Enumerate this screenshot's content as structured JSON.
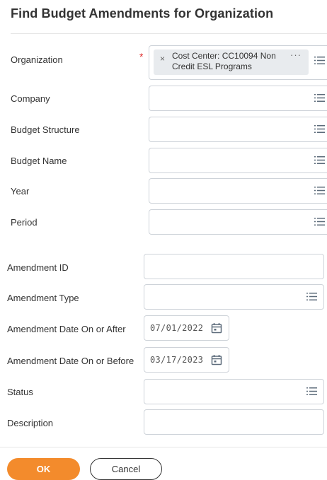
{
  "header": {
    "title": "Find Budget Amendments for Organization"
  },
  "form": {
    "organization": {
      "label": "Organization",
      "required_mark": "*",
      "selected_line1": "Cost Center: CC10094 Non",
      "selected_line2": "Credit ESL Programs",
      "remove_glyph": "×",
      "more_glyph": "···"
    },
    "company": {
      "label": "Company"
    },
    "budget_structure": {
      "label": "Budget Structure"
    },
    "budget_name": {
      "label": "Budget Name"
    },
    "year": {
      "label": "Year"
    },
    "period": {
      "label": "Period"
    },
    "amendment_id": {
      "label": "Amendment ID"
    },
    "amendment_type": {
      "label": "Amendment Type"
    },
    "date_after": {
      "label": "Amendment Date On or After",
      "value": "07/01/2022"
    },
    "date_before": {
      "label": "Amendment Date On or Before",
      "value": "03/17/2023"
    },
    "status": {
      "label": "Status"
    },
    "description": {
      "label": "Description"
    }
  },
  "buttons": {
    "ok": "OK",
    "cancel": "Cancel"
  },
  "icons": {
    "list": "list-icon",
    "calendar": "calendar-icon",
    "remove": "close-icon",
    "more": "more-icon"
  },
  "colors": {
    "primary_button": "#f38b2c",
    "required": "#de2b2b",
    "border": "#ced3d9",
    "pill": "#e8ebee"
  }
}
